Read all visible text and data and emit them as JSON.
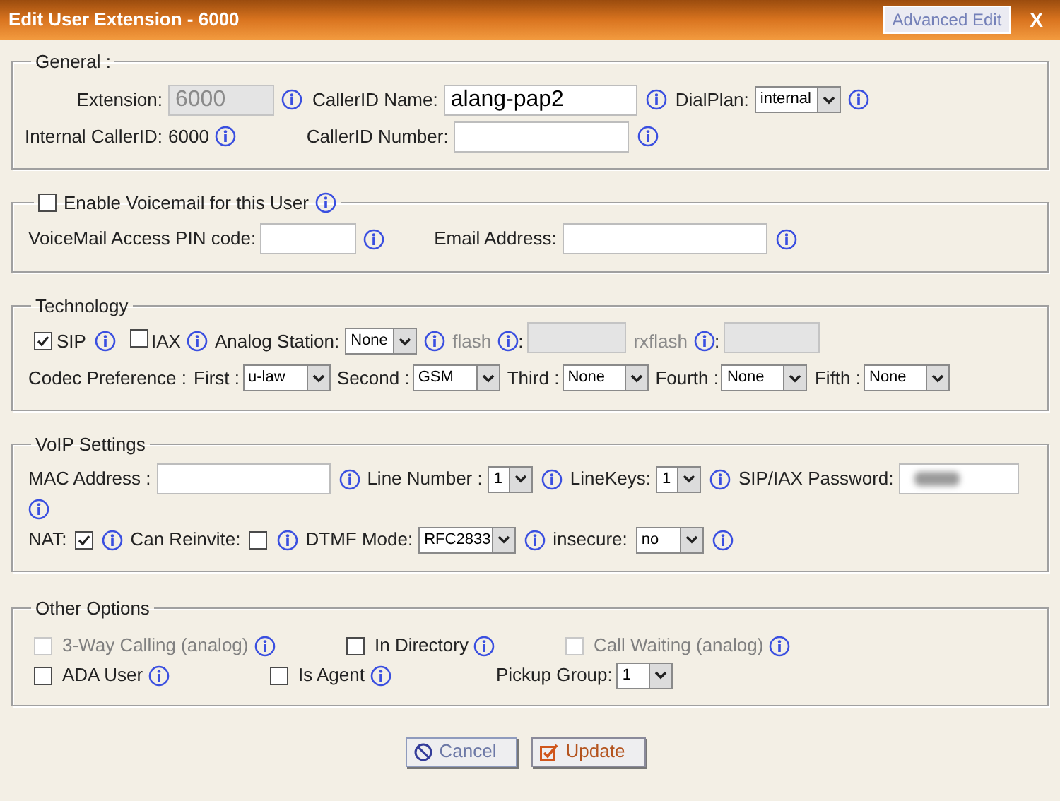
{
  "window": {
    "title": "Edit User Extension - 6000",
    "advanced_button": "Advanced Edit",
    "close_button": "X"
  },
  "general": {
    "legend": "General :",
    "extension": {
      "label": "Extension:",
      "value": "6000",
      "disabled": true
    },
    "callerid_name": {
      "label": "CallerID Name:",
      "value": "alang-pap2"
    },
    "dialplan": {
      "label": "DialPlan:",
      "value": "internal"
    },
    "internal_callerid": {
      "label": "Internal CallerID:",
      "value": "6000"
    },
    "callerid_number": {
      "label": "CallerID Number:"
    }
  },
  "voicemail": {
    "label": "Enable Voicemail for this User",
    "checked": false,
    "pin": {
      "label": "VoiceMail Access PIN code:"
    },
    "email": {
      "label": "Email Address:"
    }
  },
  "technology": {
    "legend": "Technology",
    "sip": {
      "label": "SIP",
      "checked": true
    },
    "iax": {
      "label": "IAX",
      "checked": false
    },
    "analog_station": {
      "label": "Analog Station:",
      "value": "None"
    },
    "flash": {
      "label": "flash",
      "suffix": ":",
      "disabled": true
    },
    "rxflash": {
      "label": "rxflash",
      "suffix": ":",
      "disabled": true
    },
    "codec_label": "Codec Preference :",
    "codecs": [
      {
        "label": "First :",
        "value": "u-law"
      },
      {
        "label": "Second :",
        "value": "GSM"
      },
      {
        "label": "Third :",
        "value": "None"
      },
      {
        "label": "Fourth :",
        "value": "None"
      },
      {
        "label": "Fifth :",
        "value": "None"
      }
    ]
  },
  "voip": {
    "legend": "VoIP Settings",
    "mac": {
      "label": "MAC Address :"
    },
    "line_number": {
      "label": "Line Number :",
      "value": "1"
    },
    "linekeys": {
      "label": "LineKeys:",
      "value": "1"
    },
    "password": {
      "label": "SIP/IAX Password:"
    },
    "nat": {
      "label": "NAT:",
      "checked": true
    },
    "reinvite": {
      "label": "Can Reinvite:",
      "checked": false
    },
    "dtmf": {
      "label": "DTMF Mode:",
      "value": "RFC2833"
    },
    "insecure": {
      "label": "insecure:",
      "value": "no"
    }
  },
  "other": {
    "legend": "Other Options",
    "rows": [
      [
        {
          "kind": "checkbox",
          "label": "3-Way Calling (analog)",
          "checked": false,
          "disabled": true
        },
        {
          "kind": "checkbox",
          "label": "In Directory",
          "checked": false,
          "disabled": false
        },
        {
          "kind": "checkbox",
          "label": "Call Waiting (analog)",
          "checked": false,
          "disabled": true
        }
      ],
      [
        {
          "kind": "checkbox",
          "label": "ADA User",
          "checked": false,
          "disabled": false
        },
        {
          "kind": "checkbox",
          "label": "Is Agent",
          "checked": false,
          "disabled": false
        },
        {
          "kind": "select",
          "label": "Pickup Group:",
          "value": "1"
        }
      ]
    ]
  },
  "buttons": [
    {
      "kind": "cancel",
      "label": "Cancel"
    },
    {
      "kind": "update",
      "label": "Update"
    }
  ]
}
